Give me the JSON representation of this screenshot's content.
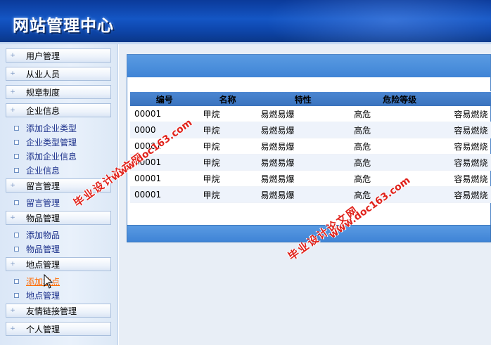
{
  "header": {
    "title": "网站管理中心"
  },
  "sidebar": {
    "groups": [
      {
        "label": "用户管理"
      },
      {
        "label": "从业人员"
      },
      {
        "label": "规章制度"
      },
      {
        "label": "企业信息",
        "items": [
          "添加企业类型",
          "企业类型管理",
          "添加企业信息",
          "企业信息"
        ]
      },
      {
        "label": "留言管理",
        "items": [
          "留言管理"
        ]
      },
      {
        "label": "物品管理",
        "items": [
          "添加物品",
          "物品管理"
        ]
      },
      {
        "label": "地点管理",
        "items": [
          "添加地点",
          "地点管理"
        ]
      },
      {
        "label": "友情链接管理"
      },
      {
        "label": "个人管理"
      }
    ]
  },
  "table": {
    "headers": [
      "编号",
      "名称",
      "特性",
      "危险等级"
    ],
    "rows": [
      [
        "00001",
        "甲烷",
        "易燃易爆",
        "高危",
        "容易燃烧"
      ],
      [
        "0000",
        "甲烷",
        "易燃易爆",
        "高危",
        "容易燃烧"
      ],
      [
        "00001",
        "甲烷",
        "易燃易爆",
        "高危",
        "容易燃烧"
      ],
      [
        "00001",
        "甲烷",
        "易燃易爆",
        "高危",
        "容易燃烧"
      ],
      [
        "00001",
        "甲烷",
        "易燃易爆",
        "高危",
        "容易燃烧"
      ],
      [
        "00001",
        "甲烷",
        "易燃易爆",
        "高危",
        "容易燃烧"
      ]
    ]
  },
  "watermark": {
    "site": "毕业设计论文网",
    "url": "www.doc163.com"
  },
  "colors": {
    "header": "#1456c4",
    "panel_bar": "#3f84d6",
    "watermark": "#e0221b",
    "link": "#1a2f8a",
    "active_link": "#ff6a00"
  }
}
